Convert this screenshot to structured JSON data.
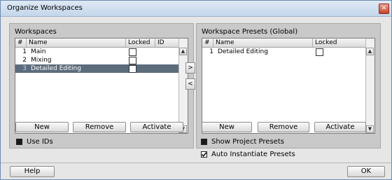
{
  "window": {
    "title": "Organize Workspaces",
    "close_glyph": "×"
  },
  "workspaces": {
    "label": "Workspaces",
    "columns": [
      "#",
      "Name",
      "Locked",
      "ID"
    ],
    "rows": [
      {
        "num": "1",
        "name": "Main",
        "locked": false,
        "selected": false
      },
      {
        "num": "2",
        "name": "Mixing",
        "locked": false,
        "selected": false
      },
      {
        "num": "3",
        "name": "Detailed Editing",
        "locked": false,
        "selected": true
      }
    ],
    "buttons": {
      "new": "New",
      "remove": "Remove",
      "activate": "Activate"
    },
    "use_ids": {
      "label": "Use IDs",
      "checked": false
    }
  },
  "transfer": {
    "right": ">",
    "left": "<"
  },
  "presets": {
    "label": "Workspace Presets (Global)",
    "columns": [
      "#",
      "Name",
      "Locked"
    ],
    "rows": [
      {
        "num": "1",
        "name": "Detailed Editing",
        "locked": false
      }
    ],
    "buttons": {
      "new": "New",
      "remove": "Remove",
      "activate": "Activate"
    },
    "show_project_presets": {
      "label": "Show Project Presets",
      "checked": false
    },
    "auto_instantiate": {
      "label": "Auto Instantiate Presets",
      "checked": true
    }
  },
  "footer": {
    "help": "Help",
    "ok": "OK"
  },
  "icons": {
    "scroll_up": "chevron-up-icon",
    "scroll_down": "chevron-down-icon",
    "check": "checkmark-icon"
  },
  "colors": {
    "selection": "#5c6c7d",
    "panel": "#c9c9c9",
    "titlebar": "#c3d6ea"
  }
}
